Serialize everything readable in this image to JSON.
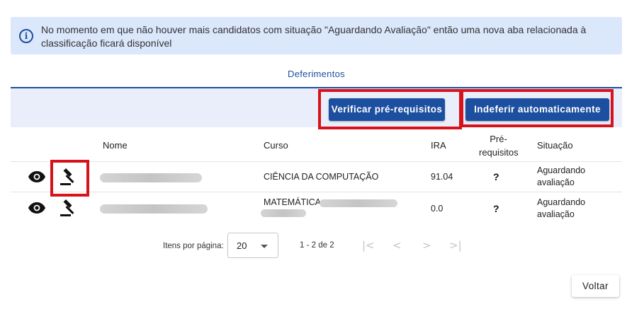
{
  "alert": {
    "icon": "info-icon",
    "text": "No momento em que não houver mais candidatos com situação \"Aguardando Avaliação\" então uma nova aba relacionada à classificação ficará disponível"
  },
  "tab": {
    "label": "Deferimentos"
  },
  "toolbar": {
    "verify_label": "Verificar pré-requisitos",
    "reject_label": "Indeferir automaticamente"
  },
  "table": {
    "headers": {
      "name": "Nome",
      "course": "Curso",
      "ira": "IRA",
      "prereq": "Pré-\nrequisitos",
      "status": "Situação"
    },
    "rows": [
      {
        "course": "CIÊNCIA DA COMPUTAÇÃO",
        "ira": "91.04",
        "prereq": "?",
        "status": "Aguardando\navaliação"
      },
      {
        "course": "MATEMÁTICA",
        "ira": "0.0",
        "prereq": "?",
        "status": "Aguardando\navaliação"
      }
    ]
  },
  "pagination": {
    "items_per_page_label": "Itens por página:",
    "page_size": "20",
    "range": "1 - 2 de 2",
    "first_icon": "|<",
    "prev_icon": "<",
    "next_icon": ">",
    "last_icon": ">|"
  },
  "footer": {
    "back_label": "Voltar"
  },
  "colors": {
    "primary": "#1c4fa0",
    "alert_bg": "#dbe7fb",
    "highlight": "#d7121b",
    "toolbar_bg": "#e9eefa"
  }
}
